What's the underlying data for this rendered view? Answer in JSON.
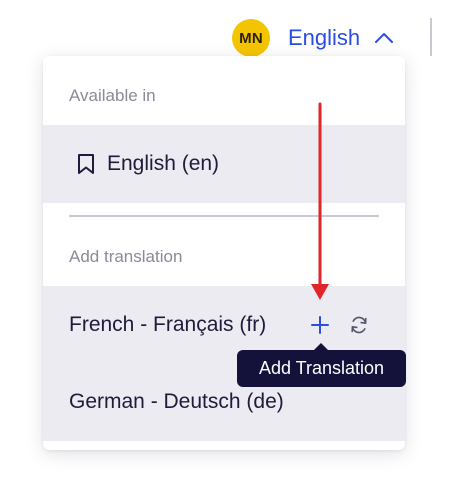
{
  "header": {
    "avatar_initials": "MN",
    "avatar_color": "#f5c400",
    "language_label": "English",
    "language_color": "#2b4de3",
    "toggle_icon": "chevron-up-icon"
  },
  "dropdown": {
    "available_header": "Available in",
    "available_items": [
      {
        "label": "English (en)",
        "icon": "bookmark-icon"
      }
    ],
    "add_header": "Add translation",
    "add_items": [
      {
        "label": "French - Français (fr)",
        "actions": [
          "plus-icon",
          "sync-icon"
        ]
      },
      {
        "label": "German - Deutsch (de)"
      }
    ]
  },
  "tooltip": {
    "text": "Add Translation",
    "background": "#14123a"
  },
  "annotation": {
    "arrow_color": "#e0262b"
  }
}
